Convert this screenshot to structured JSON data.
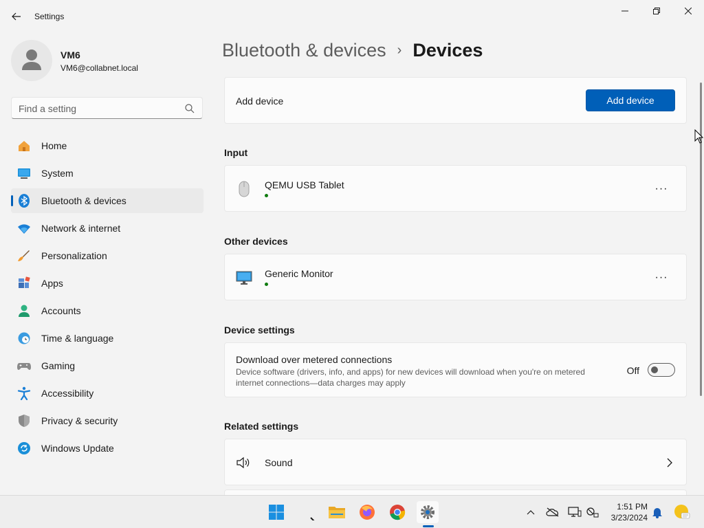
{
  "app": {
    "title": "Settings"
  },
  "profile": {
    "name": "VM6",
    "email": "VM6@collabnet.local"
  },
  "search": {
    "placeholder": "Find a setting"
  },
  "nav": {
    "items": [
      {
        "label": "Home",
        "icon": "home-icon"
      },
      {
        "label": "System",
        "icon": "system-icon"
      },
      {
        "label": "Bluetooth & devices",
        "icon": "bluetooth-icon",
        "active": true
      },
      {
        "label": "Network & internet",
        "icon": "wifi-icon"
      },
      {
        "label": "Personalization",
        "icon": "brush-icon"
      },
      {
        "label": "Apps",
        "icon": "apps-icon"
      },
      {
        "label": "Accounts",
        "icon": "accounts-icon"
      },
      {
        "label": "Time & language",
        "icon": "clock-globe-icon"
      },
      {
        "label": "Gaming",
        "icon": "gamepad-icon"
      },
      {
        "label": "Accessibility",
        "icon": "accessibility-icon"
      },
      {
        "label": "Privacy & security",
        "icon": "shield-icon"
      },
      {
        "label": "Windows Update",
        "icon": "update-icon"
      }
    ]
  },
  "breadcrumb": {
    "parent": "Bluetooth & devices",
    "separator": "›",
    "current": "Devices"
  },
  "add_device": {
    "label": "Add device",
    "button": "Add device"
  },
  "sections": {
    "input": "Input",
    "other": "Other devices",
    "device_settings": "Device settings",
    "related": "Related settings"
  },
  "devices": {
    "input": [
      {
        "name": "QEMU USB Tablet",
        "icon": "mouse-icon",
        "status_color": "#0f7b0f"
      }
    ],
    "other": [
      {
        "name": "Generic Monitor",
        "icon": "monitor-icon",
        "status_color": "#0f7b0f"
      }
    ]
  },
  "device_settings": {
    "metered": {
      "title": "Download over metered connections",
      "description": "Device software (drivers, info, and apps) for new devices will download when you're on metered internet connections—data charges may apply",
      "state_label": "Off",
      "enabled": false
    }
  },
  "related": {
    "items": [
      {
        "label": "Sound",
        "icon": "speaker-icon"
      }
    ]
  },
  "more_glyph": "···",
  "taskbar": {
    "apps": [
      "start-icon",
      "search-taskbar-icon",
      "file-explorer-icon",
      "firefox-icon",
      "chrome-icon",
      "settings-gear-icon"
    ],
    "active_app": "settings-gear-icon",
    "tray": [
      "chevron-up-icon",
      "onedrive-offline-icon",
      "display-icon",
      "network-status-icon",
      "notification-bell-icon",
      "preview-badge-icon"
    ],
    "time": "1:51 PM",
    "date": "3/23/2024"
  },
  "colors": {
    "accent": "#005fb8",
    "status_ok": "#0f7b0f",
    "background": "#f3f3f3",
    "card": "#fbfbfb"
  }
}
